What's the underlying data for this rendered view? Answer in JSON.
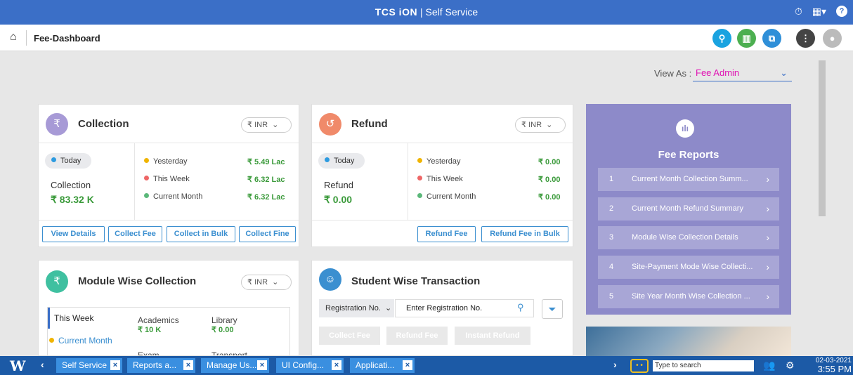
{
  "topbar": {
    "brand": "TCS iON",
    "app": "Self Service"
  },
  "header": {
    "title": "Fee-Dashboard"
  },
  "view_as": {
    "label": "View As :",
    "value": "Fee Admin"
  },
  "collection": {
    "title": "Collection",
    "currency": "INR",
    "pill": "Today",
    "label": "Collection",
    "amount": "₹ 83.32 K",
    "rows": [
      {
        "label": "Yesterday",
        "value": "₹ 5.49 Lac"
      },
      {
        "label": "This Week",
        "value": "₹ 6.32 Lac"
      },
      {
        "label": "Current Month",
        "value": "₹ 6.32 Lac"
      }
    ],
    "buttons": [
      "View Details",
      "Collect Fee",
      "Collect in Bulk",
      "Collect Fine"
    ]
  },
  "refund": {
    "title": "Refund",
    "currency": "INR",
    "pill": "Today",
    "label": "Refund",
    "amount": "₹ 0.00",
    "rows": [
      {
        "label": "Yesterday",
        "value": "₹ 0.00"
      },
      {
        "label": "This Week",
        "value": "₹ 0.00"
      },
      {
        "label": "Current Month",
        "value": "₹ 0.00"
      }
    ],
    "buttons": [
      "Refund Fee",
      "Refund Fee in Bulk"
    ]
  },
  "fee_reports": {
    "title": "Fee Reports",
    "items": [
      {
        "n": "1",
        "label": "Current Month Collection Summ..."
      },
      {
        "n": "2",
        "label": "Current Month Refund Summary"
      },
      {
        "n": "3",
        "label": "Module Wise Collection Details"
      },
      {
        "n": "4",
        "label": "Site-Payment Mode Wise Collecti..."
      },
      {
        "n": "5",
        "label": "Site Year Month Wise Collection ..."
      }
    ]
  },
  "module_wise": {
    "title": "Module Wise Collection",
    "currency": "INR",
    "tabs": [
      "This Week",
      "Current Month"
    ],
    "items": [
      {
        "label": "Academics",
        "value": "₹ 10 K"
      },
      {
        "label": "Library",
        "value": "₹ 0.00"
      },
      {
        "label": "Exam",
        "value": ""
      },
      {
        "label": "Transport",
        "value": ""
      }
    ]
  },
  "student_wise": {
    "title": "Student Wise Transaction",
    "select": "Registration No.",
    "input": "Enter Registration No.",
    "buttons": [
      "Collect Fee",
      "Refund Fee",
      "Instant Refund"
    ]
  },
  "taskbar": {
    "items": [
      "Self Service",
      "Reports a...",
      "Manage Us...",
      "UI Config...",
      "Applicati..."
    ],
    "search_placeholder": "Type to search",
    "date": "02-03-2021",
    "time": "3:55 PM"
  },
  "colors": {
    "primary": "#3b6fc7",
    "accent_magenta": "#e012b3",
    "reports_bg": "#8d8ac9",
    "green": "#3a9a3a",
    "link": "#3b8fd0"
  }
}
